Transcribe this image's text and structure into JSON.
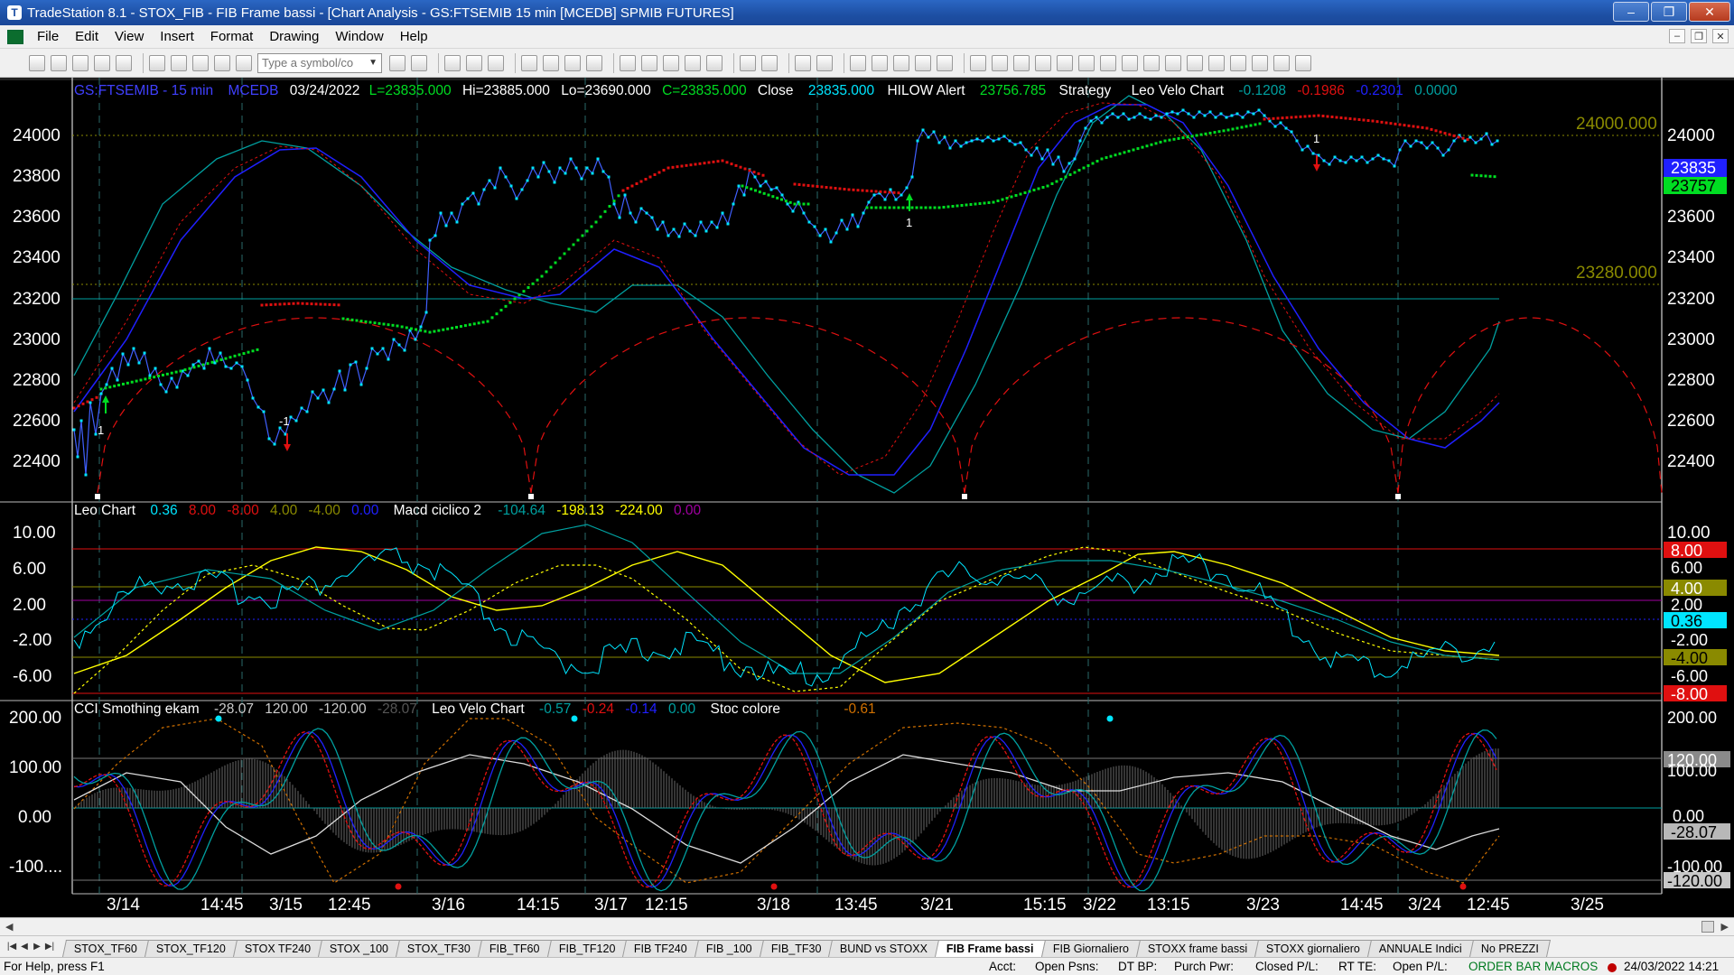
{
  "window": {
    "title": "TradeStation 8.1 - STOX_FIB - FIB Frame bassi - [Chart Analysis - GS:FTSEMIB 15 min  [MCEDB] SPMIB FUTURES]"
  },
  "menu": [
    "File",
    "Edit",
    "View",
    "Insert",
    "Format",
    "Drawing",
    "Window",
    "Help"
  ],
  "toolbar": {
    "symbol_placeholder": "Type a symbol/co"
  },
  "chart": {
    "header": {
      "symbol": "GS:FTSEMIB - 15 min",
      "exchange": "MCEDB",
      "date": "03/24/2022",
      "last": "L=23835.000",
      "hi": "Hi=23885.000",
      "lo": "Lo=23690.000",
      "close_c": "C=23835.000",
      "close_label": "Close",
      "close_value": "23835.000",
      "hilow_label": "HILOW Alert",
      "hilow_value": "23756.785",
      "strategy": "Strategy",
      "leo_label": "Leo Velo Chart",
      "leo_v1": "-0.1208",
      "leo_v2": "-0.1986",
      "leo_v3": "-0.2301",
      "leo_v4": "0.0000"
    },
    "price_axis": [
      "24000",
      "23800",
      "23600",
      "23400",
      "23200",
      "23000",
      "22800",
      "22600",
      "22400"
    ],
    "price_lines": {
      "upper": "24000.000",
      "lower": "23280.000"
    },
    "price_markers": {
      "last": "23835",
      "alert": "23757"
    },
    "signal_labels": [
      "1",
      "-1",
      "1",
      "1"
    ],
    "time_labels": [
      "3/14",
      "14:45",
      "3/15",
      "12:45",
      "3/16",
      "14:15",
      "3/17",
      "12:15",
      "3/18",
      "13:45",
      "3/21",
      "15:15",
      "3/22",
      "13:15",
      "3/23",
      "14:45",
      "3/24",
      "12:45",
      "3/25"
    ],
    "panel2": {
      "title": "Leo Chart",
      "v1": "0.36",
      "v2": "8.00",
      "v3": "-8.00",
      "v4": "4.00",
      "v5": "-4.00",
      "v6": "0.00",
      "macd_label": "Macd ciclico 2",
      "m1": "-104.64",
      "m2": "-198.13",
      "m3": "-224.00",
      "m4": "0.00",
      "axis": [
        "10.00",
        "6.00",
        "2.00",
        "-2.00",
        "-6.00"
      ],
      "markers": {
        "m8": "8.00",
        "m6": "6.00",
        "m4": "4.00",
        "m2": "2.00",
        "cur": "0.36",
        "mn2": "-2.00",
        "mn4": "-4.00",
        "mn6": "-6.00",
        "mn8": "-8.00"
      }
    },
    "panel3": {
      "title": "CCI Smothing ekam",
      "c1": "-28.07",
      "c2": "120.00",
      "c3": "-120.00",
      "c4": "-28.07",
      "leo_label": "Leo Velo Chart",
      "l1": "-0.57",
      "l2": "-0.24",
      "l3": "-0.14",
      "l4": "0.00",
      "stoc_label": "Stoc colore",
      "stoc_value": "-0.61",
      "axis": [
        "200.00",
        "100.00",
        "0.00",
        "-100...."
      ],
      "markers": {
        "m200": "200.00",
        "m120": "120.00",
        "m100": "100.00",
        "m0": "0.00",
        "cur": "-28.07",
        "mn100": "-100.00",
        "mn120": "-120.00"
      }
    }
  },
  "tabs": [
    "STOX_TF60",
    "STOX_TF120",
    "STOX TF240",
    "STOX _100",
    "STOX_TF30",
    "FIB_TF60",
    "FIB_TF120",
    "FIB TF240",
    "FIB _100",
    "FIB_TF30",
    "BUND vs STOXX",
    "FIB Frame bassi",
    "FIB Giornaliero",
    "STOXX frame bassi",
    "STOXX giornaliero",
    "ANNUALE Indici",
    "No PREZZI"
  ],
  "active_tab": "FIB Frame bassi",
  "status": {
    "help": "For Help, press F1",
    "acct": "Acct:",
    "open_psns": "Open Psns:",
    "dt_bp": "DT BP:",
    "purch_pwr": "Purch Pwr:",
    "closed_pl": "Closed P/L:",
    "rt_te": "RT TE:",
    "open_pl": "Open P/L:",
    "macros": "ORDER BAR  MACROS",
    "datetime": "24/03/2022 14:21"
  },
  "colors": {
    "price": "#00e5ff",
    "up": "#00dd22",
    "down": "#e01010",
    "blue": "#2020ff",
    "teal": "#00a0a0",
    "yellow": "#ffff00",
    "olive": "#b8b800"
  }
}
